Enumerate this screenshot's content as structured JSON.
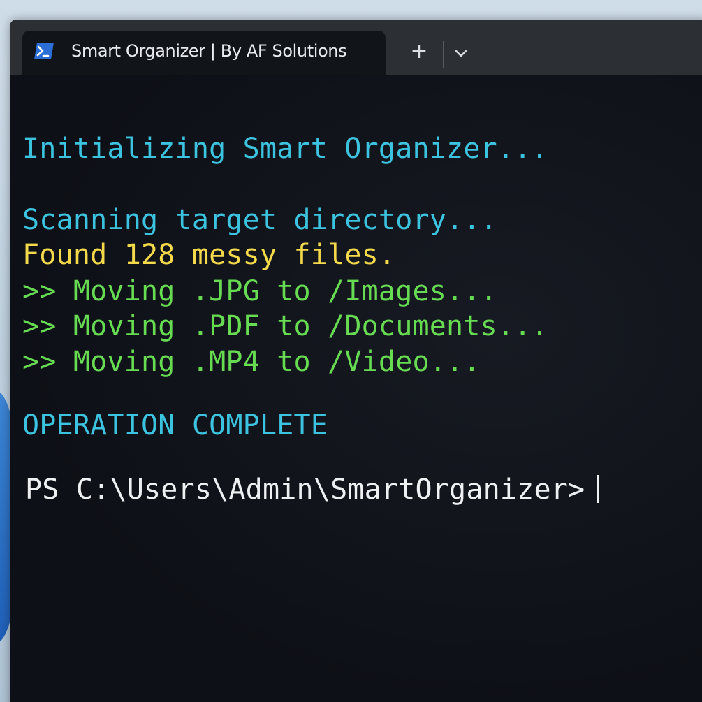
{
  "window": {
    "tab_title": "Smart Organizer | By AF Solutions",
    "new_tab_label": "+",
    "tab_icon": "powershell-icon",
    "dropdown_icon": "chevron-down-icon"
  },
  "terminal": {
    "lines": [
      "Initializing Smart Organizer...",
      "Scanning target directory...",
      "Found 128 messy files.",
      ">> Moving .JPG to /Images...",
      ">> Moving .PDF to /Documents...",
      ">> Moving .MP4 to /Video...",
      "OPERATION COMPLETE"
    ],
    "prompt": "PS C:\\Users\\Admin\\SmartOrganizer>"
  },
  "colors": {
    "cyan": "#3cc3df",
    "yellow": "#f4d94a",
    "green": "#67dc52",
    "white": "#eef0f2",
    "background": "#0e1117",
    "titlebar": "#2c2f34"
  }
}
